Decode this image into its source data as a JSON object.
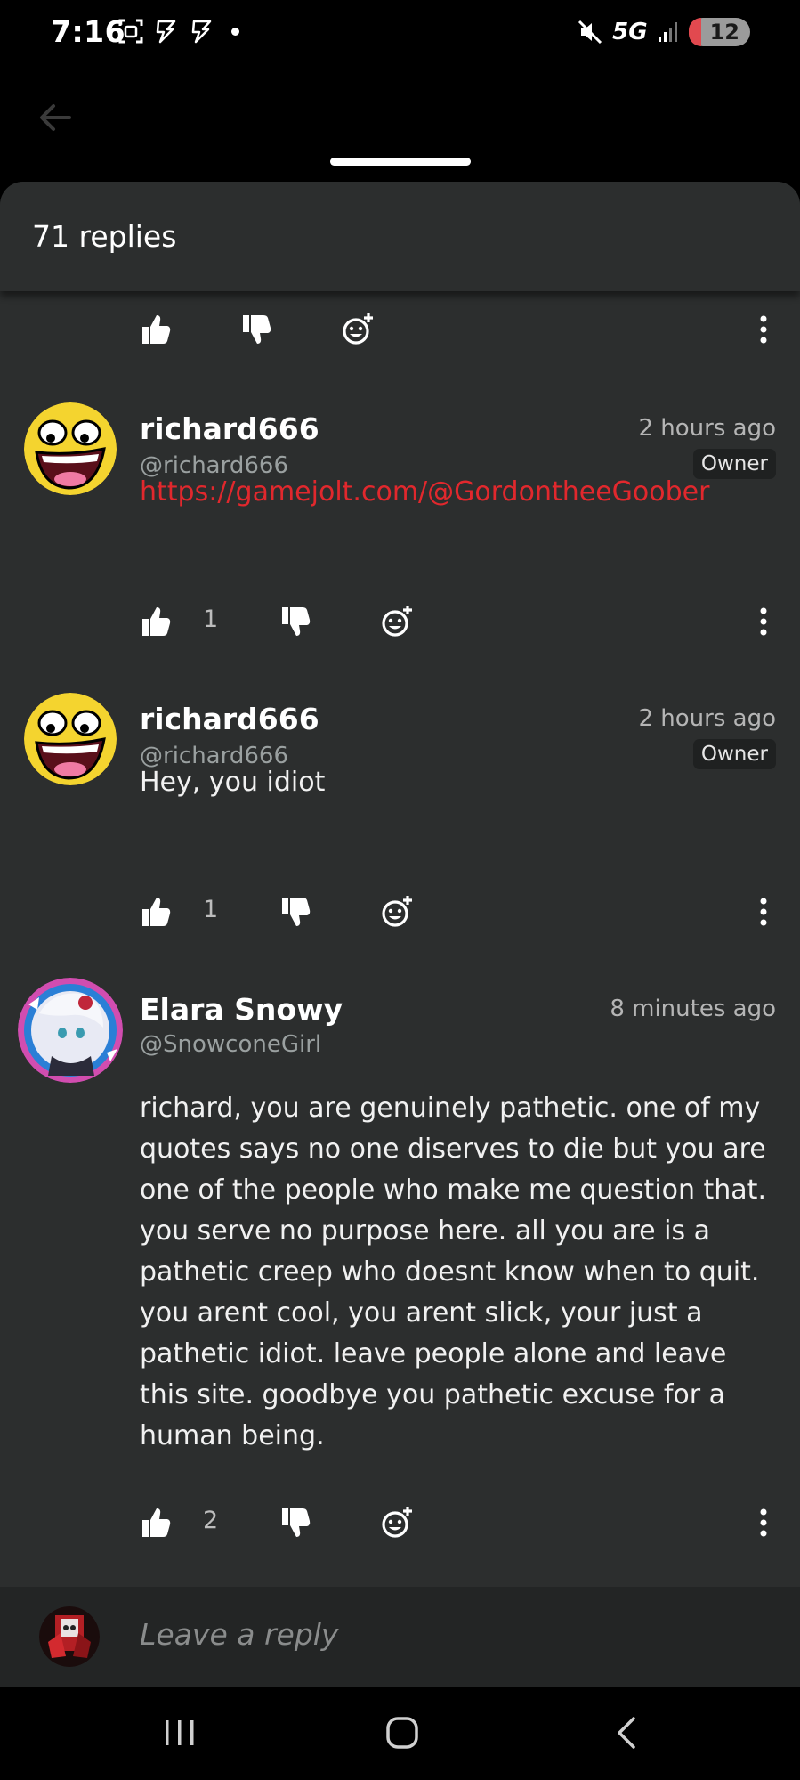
{
  "status_bar": {
    "time": "7:16",
    "network": "5G",
    "battery": "12",
    "icons_left": [
      "screenshot-icon",
      "bolt-icon",
      "bolt-icon",
      "dot"
    ],
    "icons_right": [
      "mute-icon",
      "network-5g",
      "signal-icon",
      "battery-icon"
    ]
  },
  "header": {
    "title": "71 replies"
  },
  "comments": [
    {
      "username": "richard666",
      "handle": "@richard666",
      "time": "2 hours ago",
      "badge": "Owner",
      "body": "https://gamejolt.com/@GordontheeGoober",
      "likes": "1"
    },
    {
      "username": "richard666",
      "handle": "@richard666",
      "time": "2 hours ago",
      "badge": "Owner",
      "body": "Hey, you idiot",
      "likes": "1"
    },
    {
      "username": "Elara Snowy",
      "handle": "@SnowconeGirl",
      "time": "8 minutes ago",
      "body": "richard, you are genuinely pathetic. one of my quotes says no one diserves to die but you are one of the people who make me question that. you serve no purpose here. all you are is a pathetic creep who doesnt know when to quit. you arent cool, you arent slick, your just a pathetic idiot. leave people alone and leave this site. goodbye you pathetic excuse for a human being.",
      "likes": "2"
    }
  ],
  "reply_bar": {
    "placeholder": "Leave a reply"
  },
  "colors": {
    "sheet_bg": "#2c2e2e",
    "link": "#e1282d",
    "text_muted": "#9aa0a0",
    "accent_avatar_yellow": "#f4d42f"
  }
}
